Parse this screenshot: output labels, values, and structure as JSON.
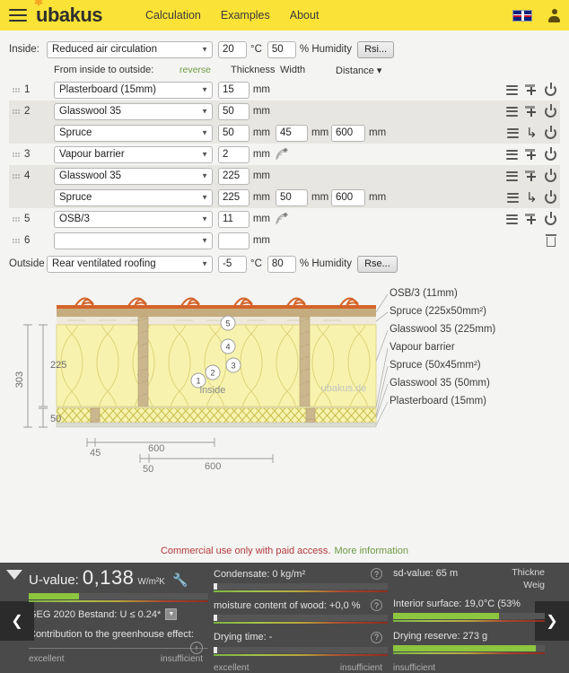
{
  "header": {
    "menu_icon": "hamburger-icon",
    "brand": "ubakus",
    "nav": [
      {
        "label": "Calculation"
      },
      {
        "label": "Examples"
      },
      {
        "label": "About"
      }
    ],
    "language_flag": "uk-flag-icon",
    "account_icon": "user-icon"
  },
  "form": {
    "inside_label": "Inside:",
    "inside_value": "Reduced air circulation",
    "inside_temp": "20",
    "inside_temp_unit": "°C",
    "inside_humidity": "50",
    "humidity_unit": "% Humidity",
    "rsi_button": "Rsi...",
    "columns": {
      "direction": "From inside to outside:",
      "reverse": "reverse",
      "thickness": "Thickness",
      "width": "Width",
      "distance": "Distance ▾"
    },
    "outside_label": "Outside",
    "outside_value": "Rear ventilated roofing",
    "outside_temp": "-5",
    "outside_humidity": "80",
    "rse_button": "Rse...",
    "mm": "mm",
    "layers": [
      {
        "num": "1",
        "material": "Plasterboard (15mm)",
        "thickness": "15",
        "width": "",
        "distance": "",
        "shaded": false,
        "sub": false,
        "wood_icon": false,
        "icons": [
          "menu",
          "add",
          "power"
        ]
      },
      {
        "num": "2",
        "material": "Glasswool 35",
        "thickness": "50",
        "width": "",
        "distance": "",
        "shaded": true,
        "sub": false,
        "wood_icon": false,
        "icons": [
          "menu",
          "add",
          "power"
        ]
      },
      {
        "num": "",
        "material": "Spruce",
        "thickness": "50",
        "width": "45",
        "distance": "600",
        "shaded": true,
        "sub": true,
        "wood_icon": false,
        "icons": [
          "menu",
          "undo",
          "power"
        ]
      },
      {
        "num": "3",
        "material": "Vapour barrier",
        "thickness": "2",
        "width": "",
        "distance": "",
        "shaded": false,
        "sub": false,
        "wood_icon": true,
        "icons": [
          "menu",
          "add",
          "power"
        ]
      },
      {
        "num": "4",
        "material": "Glasswool 35",
        "thickness": "225",
        "width": "",
        "distance": "",
        "shaded": true,
        "sub": false,
        "wood_icon": false,
        "icons": [
          "menu",
          "add",
          "power"
        ]
      },
      {
        "num": "",
        "material": "Spruce",
        "thickness": "225",
        "width": "50",
        "distance": "600",
        "shaded": true,
        "sub": true,
        "wood_icon": false,
        "icons": [
          "menu",
          "undo",
          "power"
        ]
      },
      {
        "num": "5",
        "material": "OSB/3",
        "thickness": "11",
        "width": "",
        "distance": "",
        "shaded": false,
        "sub": false,
        "wood_icon": true,
        "icons": [
          "menu",
          "add",
          "power"
        ]
      },
      {
        "num": "6",
        "material": "",
        "thickness": "",
        "width": "",
        "distance": "",
        "shaded": false,
        "sub": false,
        "wood_icon": false,
        "icons": [
          "trash"
        ]
      }
    ]
  },
  "drawing": {
    "watermark": "ubakus.de",
    "inside_label": "inside",
    "total_height": "303",
    "height_segments": [
      "225",
      "50"
    ],
    "width_dims": [
      "45",
      "600",
      "50",
      "600"
    ],
    "callouts": [
      {
        "marker": "5",
        "text": "OSB/3 (11mm)"
      },
      {
        "marker": "",
        "text": "Spruce (225x50mm²)"
      },
      {
        "marker": "4",
        "text": "Glasswool 35 (225mm)"
      },
      {
        "marker": "3",
        "text": "Vapour barrier"
      },
      {
        "marker": "",
        "text": "Spruce (50x45mm²)"
      },
      {
        "marker": "2",
        "text": "Glasswool 35 (50mm)"
      },
      {
        "marker": "1",
        "text": "Plasterboard (15mm)"
      }
    ],
    "markers": [
      "1",
      "2",
      "3",
      "4",
      "5"
    ]
  },
  "notice": {
    "text": "Commercial use only with paid access.",
    "link": "More information"
  },
  "results": {
    "collapse_icon": "triangle-down-icon",
    "prev_icon": "chevron-left-icon",
    "next_icon": "chevron-right-icon",
    "u_value_label": "U-value:",
    "u_value": "0,138",
    "u_value_unit": "W/m²K",
    "settings_icon": "wrench-icon",
    "standard": "GEG 2020 Bestand: U ≤ 0.24*",
    "greenhouse_label": "Contribution to the greenhouse effect:",
    "condensate": "Condensate: 0 kg/m²",
    "moisture": "moisture content of wood: +0,0 %",
    "drying_time": "Drying time: -",
    "sd_value": "sd-value: 65 m",
    "interior_surface": "Interior surface: 19,0°C (53%",
    "drying_reserve": "Drying reserve: 273 g",
    "thickness_clipped": "Thickne",
    "weight_clipped": "Weig",
    "scale_best": "excellent",
    "scale_worst": "insufficient",
    "scale_right_worst": "insufficient"
  },
  "colors": {
    "brand_yellow": "#fbe236",
    "accent_green": "#6f9b46",
    "bar_green": "#8cc63f",
    "panel_dark": "#4a4a4a",
    "notice_red": "#b33a3a",
    "insulation_yellow": "#f5f0a8",
    "wood_brown": "#b49a6a",
    "roof_orange": "#d4642a"
  }
}
